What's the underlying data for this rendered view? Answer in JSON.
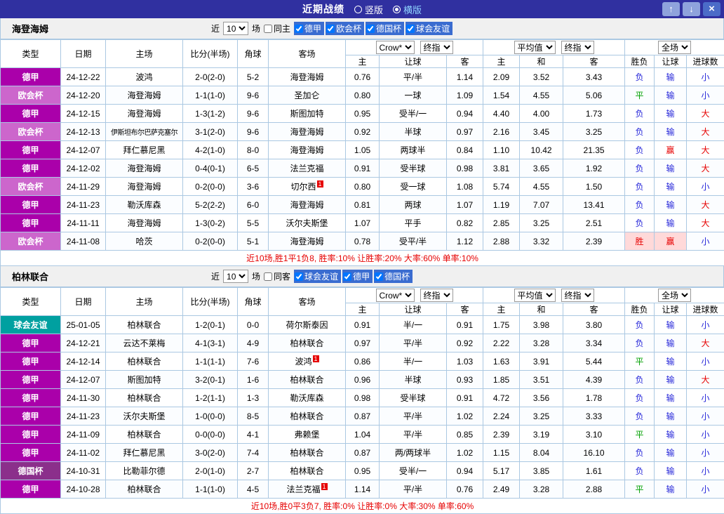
{
  "titlebar": {
    "title": "近期战绩",
    "layout_options": [
      {
        "label": "竖版",
        "selected": false
      },
      {
        "label": "横版",
        "selected": true
      }
    ],
    "buttons": {
      "up": "↑",
      "down": "↓",
      "close": "×"
    }
  },
  "columns": {
    "type": "类型",
    "date": "日期",
    "home": "主场",
    "score": "比分(半场)",
    "corner": "角球",
    "away": "客场",
    "odds_home": "主",
    "handicap": "让球",
    "odds_away": "客",
    "avg_home": "主",
    "avg_draw": "和",
    "avg_away": "客",
    "result": "胜负",
    "handicap_result": "让球",
    "goals": "进球数"
  },
  "type_colors": {
    "德甲": "#aa00aa",
    "欧会杯": "#cc66cc",
    "德国杯": "#8b2f8b",
    "球会友谊": "#00a0a0"
  },
  "result_colors": {
    "胜": "#e60000",
    "平": "#00a000",
    "负": "#2626d9",
    "赢": "#e60000",
    "输": "#2626d9",
    "大": "#e60000",
    "小": "#2626d9"
  },
  "sections": [
    {
      "team": "海登海姆",
      "filter": {
        "near": "近",
        "count": "10",
        "games": "场",
        "same": "同主",
        "leagues": [
          "德甲",
          "欧会杯",
          "德国杯",
          "球会友谊"
        ]
      },
      "selects": {
        "odds_provider": "Crow*",
        "odds_stage": "终指",
        "avg": "平均值",
        "avg_stage": "终指",
        "scope": "全场"
      },
      "rows": [
        {
          "type": "德甲",
          "date": "24-12-22",
          "home": "波鸿",
          "score": "2-0(2-0)",
          "corner": "5-2",
          "away": "海登海姆",
          "odds_home": "0.76",
          "handicap": "平/半",
          "odds_away": "1.14",
          "avg_home": "2.09",
          "avg_draw": "3.52",
          "avg_away": "3.43",
          "result": "负",
          "handicap_result": "输",
          "goals": "小"
        },
        {
          "type": "欧会杯",
          "date": "24-12-20",
          "home": "海登海姆",
          "score": "1-1(1-0)",
          "corner": "9-6",
          "away": "圣加仑",
          "odds_home": "0.80",
          "handicap": "一球",
          "odds_away": "1.09",
          "avg_home": "1.54",
          "avg_draw": "4.55",
          "avg_away": "5.06",
          "result": "平",
          "handicap_result": "输",
          "goals": "小"
        },
        {
          "type": "德甲",
          "date": "24-12-15",
          "home": "海登海姆",
          "score": "1-3(1-2)",
          "corner": "9-6",
          "away": "斯图加特",
          "odds_home": "0.95",
          "handicap": "受半/一",
          "odds_away": "0.94",
          "avg_home": "4.40",
          "avg_draw": "4.00",
          "avg_away": "1.73",
          "result": "负",
          "handicap_result": "输",
          "goals": "大"
        },
        {
          "type": "欧会杯",
          "date": "24-12-13",
          "home": "伊斯坦布尔巴萨克塞尔",
          "score": "3-1(2-0)",
          "corner": "9-6",
          "away": "海登海姆",
          "odds_home": "0.92",
          "handicap": "半球",
          "odds_away": "0.97",
          "avg_home": "2.16",
          "avg_draw": "3.45",
          "avg_away": "3.25",
          "result": "负",
          "handicap_result": "输",
          "goals": "大"
        },
        {
          "type": "德甲",
          "date": "24-12-07",
          "home": "拜仁慕尼黑",
          "score": "4-2(1-0)",
          "corner": "8-0",
          "away": "海登海姆",
          "odds_home": "1.05",
          "handicap": "两球半",
          "odds_away": "0.84",
          "avg_home": "1.10",
          "avg_draw": "10.42",
          "avg_away": "21.35",
          "result": "负",
          "handicap_result": "赢",
          "goals": "大"
        },
        {
          "type": "德甲",
          "date": "24-12-02",
          "home": "海登海姆",
          "score": "0-4(0-1)",
          "corner": "6-5",
          "away": "法兰克福",
          "odds_home": "0.91",
          "handicap": "受半球",
          "odds_away": "0.98",
          "avg_home": "3.81",
          "avg_draw": "3.65",
          "avg_away": "1.92",
          "result": "负",
          "handicap_result": "输",
          "goals": "大"
        },
        {
          "type": "欧会杯",
          "date": "24-11-29",
          "home": "海登海姆",
          "score": "0-2(0-0)",
          "corner": "3-6",
          "away": "切尔西",
          "away_badge": "1",
          "odds_home": "0.80",
          "handicap": "受一球",
          "odds_away": "1.08",
          "avg_home": "5.74",
          "avg_draw": "4.55",
          "avg_away": "1.50",
          "result": "负",
          "handicap_result": "输",
          "goals": "小"
        },
        {
          "type": "德甲",
          "date": "24-11-23",
          "home": "勒沃库森",
          "score": "5-2(2-2)",
          "corner": "6-0",
          "away": "海登海姆",
          "odds_home": "0.81",
          "handicap": "两球",
          "odds_away": "1.07",
          "avg_home": "1.19",
          "avg_draw": "7.07",
          "avg_away": "13.41",
          "result": "负",
          "handicap_result": "输",
          "goals": "大"
        },
        {
          "type": "德甲",
          "date": "24-11-11",
          "home": "海登海姆",
          "score": "1-3(0-2)",
          "corner": "5-5",
          "away": "沃尔夫斯堡",
          "odds_home": "1.07",
          "handicap": "平手",
          "odds_away": "0.82",
          "avg_home": "2.85",
          "avg_draw": "3.25",
          "avg_away": "2.51",
          "result": "负",
          "handicap_result": "输",
          "goals": "大"
        },
        {
          "type": "欧会杯",
          "date": "24-11-08",
          "home": "哈茨",
          "score": "0-2(0-0)",
          "corner": "5-1",
          "away": "海登海姆",
          "odds_home": "0.78",
          "handicap": "受平/半",
          "odds_away": "1.12",
          "avg_home": "2.88",
          "avg_draw": "3.32",
          "avg_away": "2.39",
          "result": "胜",
          "handicap_result": "赢",
          "goals": "小",
          "hl": true
        }
      ],
      "summary": "近10场,胜1平1负8, 胜率:10% 让胜率:20% 大率:60% 单率:10%"
    },
    {
      "team": "柏林联合",
      "filter": {
        "near": "近",
        "count": "10",
        "games": "场",
        "same": "同客",
        "leagues": [
          "球会友谊",
          "德甲",
          "德国杯"
        ]
      },
      "selects": {
        "odds_provider": "Crow*",
        "odds_stage": "终指",
        "avg": "平均值",
        "avg_stage": "终指",
        "scope": "全场"
      },
      "rows": [
        {
          "type": "球会友谊",
          "date": "25-01-05",
          "home": "柏林联合",
          "score": "1-2(0-1)",
          "corner": "0-0",
          "away": "荷尔斯泰因",
          "odds_home": "0.91",
          "handicap": "半/一",
          "odds_away": "0.91",
          "avg_home": "1.75",
          "avg_draw": "3.98",
          "avg_away": "3.80",
          "result": "负",
          "handicap_result": "输",
          "goals": "小"
        },
        {
          "type": "德甲",
          "date": "24-12-21",
          "home": "云达不莱梅",
          "score": "4-1(3-1)",
          "corner": "4-9",
          "away": "柏林联合",
          "odds_home": "0.97",
          "handicap": "平/半",
          "odds_away": "0.92",
          "avg_home": "2.22",
          "avg_draw": "3.28",
          "avg_away": "3.34",
          "result": "负",
          "handicap_result": "输",
          "goals": "大"
        },
        {
          "type": "德甲",
          "date": "24-12-14",
          "home": "柏林联合",
          "score": "1-1(1-1)",
          "corner": "7-6",
          "away": "波鸿",
          "away_badge": "1",
          "odds_home": "0.86",
          "handicap": "半/一",
          "odds_away": "1.03",
          "avg_home": "1.63",
          "avg_draw": "3.91",
          "avg_away": "5.44",
          "result": "平",
          "handicap_result": "输",
          "goals": "小"
        },
        {
          "type": "德甲",
          "date": "24-12-07",
          "home": "斯图加特",
          "score": "3-2(0-1)",
          "corner": "1-6",
          "away": "柏林联合",
          "odds_home": "0.96",
          "handicap": "半球",
          "odds_away": "0.93",
          "avg_home": "1.85",
          "avg_draw": "3.51",
          "avg_away": "4.39",
          "result": "负",
          "handicap_result": "输",
          "goals": "大"
        },
        {
          "type": "德甲",
          "date": "24-11-30",
          "home": "柏林联合",
          "score": "1-2(1-1)",
          "corner": "1-3",
          "away": "勒沃库森",
          "odds_home": "0.98",
          "handicap": "受半球",
          "odds_away": "0.91",
          "avg_home": "4.72",
          "avg_draw": "3.56",
          "avg_away": "1.78",
          "result": "负",
          "handicap_result": "输",
          "goals": "小"
        },
        {
          "type": "德甲",
          "date": "24-11-23",
          "home": "沃尔夫斯堡",
          "score": "1-0(0-0)",
          "corner": "8-5",
          "away": "柏林联合",
          "odds_home": "0.87",
          "handicap": "平/半",
          "odds_away": "1.02",
          "avg_home": "2.24",
          "avg_draw": "3.25",
          "avg_away": "3.33",
          "result": "负",
          "handicap_result": "输",
          "goals": "小"
        },
        {
          "type": "德甲",
          "date": "24-11-09",
          "home": "柏林联合",
          "score": "0-0(0-0)",
          "corner": "4-1",
          "away": "弗赖堡",
          "odds_home": "1.04",
          "handicap": "平/半",
          "odds_away": "0.85",
          "avg_home": "2.39",
          "avg_draw": "3.19",
          "avg_away": "3.10",
          "result": "平",
          "handicap_result": "输",
          "goals": "小"
        },
        {
          "type": "德甲",
          "date": "24-11-02",
          "home": "拜仁慕尼黑",
          "score": "3-0(2-0)",
          "corner": "7-4",
          "away": "柏林联合",
          "odds_home": "0.87",
          "handicap": "两/两球半",
          "odds_away": "1.02",
          "avg_home": "1.15",
          "avg_draw": "8.04",
          "avg_away": "16.10",
          "result": "负",
          "handicap_result": "输",
          "goals": "小"
        },
        {
          "type": "德国杯",
          "date": "24-10-31",
          "home": "比勒菲尔德",
          "score": "2-0(1-0)",
          "corner": "2-7",
          "away": "柏林联合",
          "odds_home": "0.95",
          "handicap": "受半/一",
          "odds_away": "0.94",
          "avg_home": "5.17",
          "avg_draw": "3.85",
          "avg_away": "1.61",
          "result": "负",
          "handicap_result": "输",
          "goals": "小"
        },
        {
          "type": "德甲",
          "date": "24-10-28",
          "home": "柏林联合",
          "score": "1-1(1-0)",
          "corner": "4-5",
          "away": "法兰克福",
          "away_badge": "1",
          "odds_home": "1.14",
          "handicap": "平/半",
          "odds_away": "0.76",
          "avg_home": "2.49",
          "avg_draw": "3.28",
          "avg_away": "2.88",
          "result": "平",
          "handicap_result": "输",
          "goals": "小"
        }
      ],
      "summary": "近10场,胜0平3负7, 胜率:0% 让胜率:0% 大率:30% 单率:60%"
    }
  ]
}
